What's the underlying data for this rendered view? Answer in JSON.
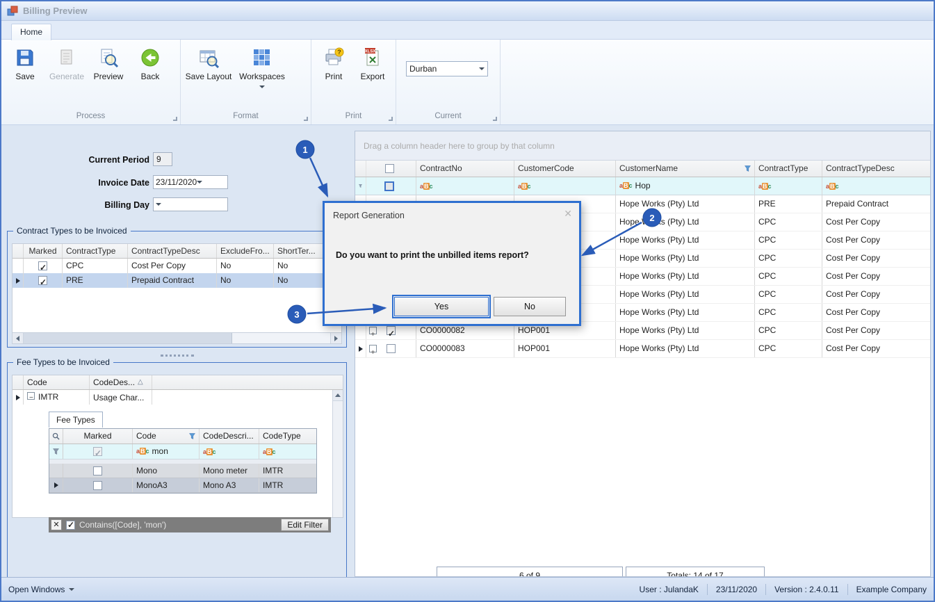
{
  "titlebar": {
    "title": "Billing Preview"
  },
  "ribbon": {
    "tab_home": "Home",
    "process": {
      "label": "Process",
      "save": "Save",
      "generate": "Generate",
      "preview": "Preview",
      "back": "Back"
    },
    "format": {
      "label": "Format",
      "save_layout": "Save Layout",
      "workspaces": "Workspaces"
    },
    "print": {
      "label": "Print",
      "print": "Print",
      "export": "Export"
    },
    "current": {
      "label": "Current",
      "combo_value": "Durban"
    }
  },
  "form": {
    "current_period_label": "Current Period",
    "current_period_value": "9",
    "invoice_date_label": "Invoice Date",
    "invoice_date_value": "23/11/2020",
    "billing_day_label": "Billing Day",
    "billing_day_value": ""
  },
  "contract_types": {
    "title": "Contract Types to be Invoiced",
    "columns": {
      "marked": "Marked",
      "type": "ContractType",
      "desc": "ContractTypeDesc",
      "exclude": "ExcludeFro...",
      "short": "ShortTer..."
    },
    "rows": [
      {
        "marked": true,
        "type": "CPC",
        "desc": "Cost Per Copy",
        "exclude": "No",
        "short": "No",
        "selected": false
      },
      {
        "marked": true,
        "type": "PRE",
        "desc": "Prepaid Contract",
        "exclude": "No",
        "short": "No",
        "selected": true
      }
    ]
  },
  "fee_types": {
    "title": "Fee Types to be Invoiced",
    "columns": {
      "code": "Code",
      "desc": "CodeDes..."
    },
    "group_row": {
      "code": "IMTR",
      "desc": "Usage Char..."
    },
    "detail": {
      "tab_label": "Fee Types",
      "columns": {
        "marked": "Marked",
        "code": "Code",
        "desc": "CodeDescri...",
        "type": "CodeType"
      },
      "filter_row": {
        "code_value": "mon",
        "marked_checked": true
      },
      "rows": [
        {
          "marked": false,
          "code": "Mono",
          "desc": "Mono meter",
          "type": "IMTR",
          "selected": false
        },
        {
          "marked": false,
          "code": "MonoA3",
          "desc": "Mono A3",
          "type": "IMTR",
          "selected": true
        }
      ],
      "filter_bar": {
        "enabled": true,
        "expression": "Contains([Code], 'mon')",
        "edit_button": "Edit Filter"
      }
    }
  },
  "right_grid": {
    "group_hint": "Drag a column header here to group by that column",
    "columns": {
      "contract_no": "ContractNo",
      "customer_code": "CustomerCode",
      "customer_name": "CustomerName",
      "contract_type": "ContractType",
      "contract_type_desc": "ContractTypeDesc"
    },
    "filter_row": {
      "customer_name_value": "Hop"
    },
    "rows": [
      {
        "contract_no": "",
        "customer_code": "",
        "customer_name": "Hope Works (Pty) Ltd",
        "contract_type": "PRE",
        "contract_type_desc": "Prepaid Contract",
        "checked": null,
        "selected": false
      },
      {
        "contract_no": "",
        "customer_code": "",
        "customer_name": "Hope Works (Pty) Ltd",
        "contract_type": "CPC",
        "contract_type_desc": "Cost Per Copy",
        "checked": null,
        "selected": false
      },
      {
        "contract_no": "",
        "customer_code": "",
        "customer_name": "Hope Works (Pty) Ltd",
        "contract_type": "CPC",
        "contract_type_desc": "Cost Per Copy",
        "checked": null,
        "selected": false
      },
      {
        "contract_no": "",
        "customer_code": "",
        "customer_name": "Hope Works (Pty) Ltd",
        "contract_type": "CPC",
        "contract_type_desc": "Cost Per Copy",
        "checked": null,
        "selected": false
      },
      {
        "contract_no": "",
        "customer_code": "",
        "customer_name": "Hope Works (Pty) Ltd",
        "contract_type": "CPC",
        "contract_type_desc": "Cost Per Copy",
        "checked": null,
        "selected": false
      },
      {
        "contract_no": "",
        "customer_code": "",
        "customer_name": "Hope Works (Pty) Ltd",
        "contract_type": "CPC",
        "contract_type_desc": "Cost Per Copy",
        "checked": null,
        "selected": false
      },
      {
        "contract_no": "",
        "customer_code": "",
        "customer_name": "Hope Works (Pty) Ltd",
        "contract_type": "CPC",
        "contract_type_desc": "Cost Per Copy",
        "checked": null,
        "selected": false
      },
      {
        "contract_no": "CO0000082",
        "customer_code": "HOP001",
        "customer_name": "Hope Works (Pty) Ltd",
        "contract_type": "CPC",
        "contract_type_desc": "Cost Per Copy",
        "checked": true,
        "selected": false
      },
      {
        "contract_no": "CO0000083",
        "customer_code": "HOP001",
        "customer_name": "Hope Works (Pty) Ltd",
        "contract_type": "CPC",
        "contract_type_desc": "Cost Per Copy",
        "checked": false,
        "selected": true
      }
    ],
    "footers": {
      "count": "6 of 9",
      "totals": "Totals: 14 of 17"
    }
  },
  "dialog": {
    "title": "Report Generation",
    "message": "Do you want to print the unbilled items report?",
    "yes_button": "Yes",
    "no_button": "No"
  },
  "annotations": [
    {
      "label": "1"
    },
    {
      "label": "2"
    },
    {
      "label": "3"
    }
  ],
  "statusbar": {
    "open_windows": "Open Windows",
    "user": "User : JulandaK",
    "date": "23/11/2020",
    "version": "Version : 2.4.0.11",
    "company": "Example Company"
  },
  "icons": {
    "abc": [
      "a",
      "B",
      "c"
    ],
    "sort_asc": "△",
    "close": "✕"
  }
}
